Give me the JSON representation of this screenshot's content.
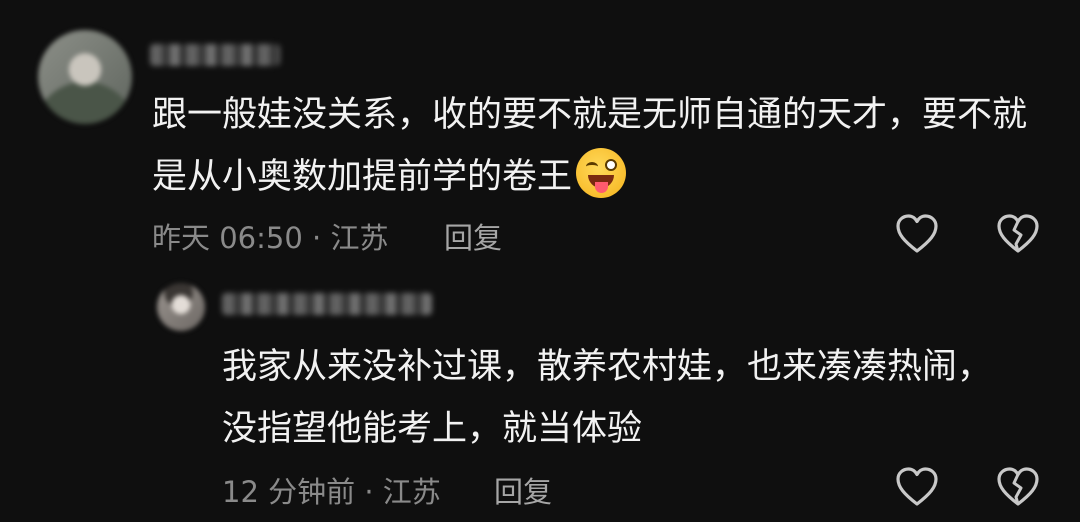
{
  "comments": {
    "main": {
      "text": "跟一般娃没关系，收的要不就是无师自通的天才，要不就是从小奥数加提前学的卷王",
      "emoji": "squinting-face-with-tongue",
      "meta": "昨天 06:50 · 江苏",
      "reply_label": "回复"
    },
    "reply": {
      "text": "我家从来没补过课，散养农村娃，也来凑凑热闹，没指望他能考上，就当体验",
      "meta": "12 分钟前 · 江苏",
      "reply_label": "回复"
    }
  },
  "icons": {
    "like": "heart-outline-icon",
    "dislike": "broken-heart-outline-icon"
  },
  "colors": {
    "background": "#0f0f0f",
    "text": "#f2f2f2",
    "meta": "#8a8a8a",
    "reply": "#a6a6a6",
    "icon": "#c8c8c8"
  }
}
